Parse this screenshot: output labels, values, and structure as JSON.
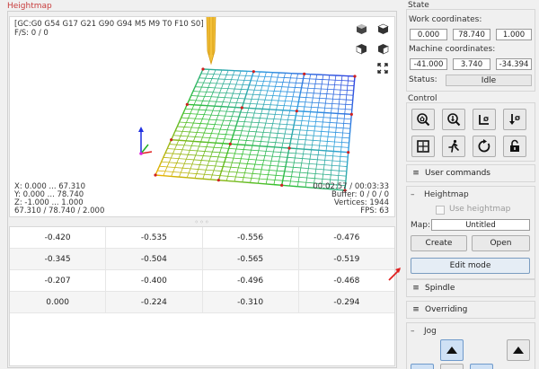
{
  "heightmap": {
    "title": "Heightmap",
    "viewport": {
      "gcode_state": "[GC:G0 G54 G17 G21 G90 G94 M5 M9 T0 F10 S0]",
      "feed_spindle": "F/S: 0 / 0",
      "x_range": "X: 0.000 ... 67.310",
      "y_range": "Y: 0.000 ... 78.740",
      "z_range": "Z: -1.000 ... 1.000",
      "dimensions": "67.310 / 78.740 / 2.000",
      "time": "00:02:57 / 00:03:33",
      "buffer": "Buffer: 0 / 0 / 0",
      "vertices": "Vertices: 1944",
      "fps": "FPS: 63"
    },
    "splitter_handle": "◦◦◦",
    "table": [
      [
        "-0.420",
        "-0.535",
        "-0.556",
        "-0.476"
      ],
      [
        "-0.345",
        "-0.504",
        "-0.565",
        "-0.519"
      ],
      [
        "-0.207",
        "-0.400",
        "-0.496",
        "-0.468"
      ],
      [
        "0.000",
        "-0.224",
        "-0.310",
        "-0.294"
      ]
    ]
  },
  "state": {
    "title": "State",
    "work_label": "Work coordinates:",
    "work": [
      "0.000",
      "78.740",
      "1.000"
    ],
    "machine_label": "Machine coordinates:",
    "machine": [
      "-41.000",
      "3.740",
      "-34.394"
    ],
    "status_label": "Status:",
    "status_value": "Idle"
  },
  "control": {
    "title": "Control"
  },
  "sections": {
    "user_commands": "User commands",
    "heightmap": "Heightmap",
    "spindle": "Spindle",
    "overriding": "Overriding",
    "jog": "Jog"
  },
  "heightmap_panel": {
    "use_heightmap": "Use heightmap",
    "map_label": "Map:",
    "map_value": "Untitled",
    "create": "Create",
    "open": "Open",
    "edit_mode": "Edit mode"
  },
  "colors": {
    "title_red": "#c83c3c",
    "annotation_arrow": "#e02020"
  }
}
